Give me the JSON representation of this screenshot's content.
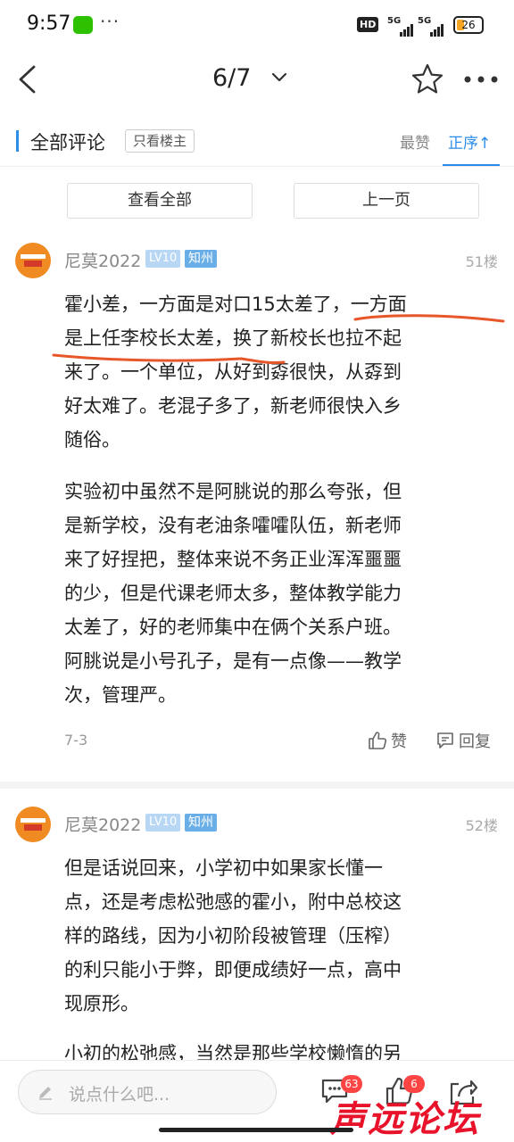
{
  "status_bar": {
    "time": "9:57",
    "dots": "···",
    "hd": "HD",
    "signal1": "5G",
    "signal2": "5G",
    "battery": "26"
  },
  "nav": {
    "page": "6/7"
  },
  "comments_header": {
    "title": "全部评论",
    "only_op": "只看楼主",
    "sort_hot": "最赞",
    "sort_order": "正序↑"
  },
  "buttons": {
    "view_all": "查看全部",
    "prev_page": "上一页"
  },
  "posts": [
    {
      "username": "尼莫2022",
      "level": "LV10",
      "tag": "知州",
      "floor": "51楼",
      "paragraphs": [
        [
          "霍小差，一方面是对口15太差了，一方面",
          "是上任李校长太差，换了新校长也拉不起",
          "来了。一个单位，从好到孬很快，从孬到",
          "好太难了。老混子多了，新老师很快入乡",
          "随俗。"
        ],
        [
          "实验初中虽然不是阿朓说的那么夸张，但",
          "是新学校，没有老油条嚯嚯队伍，新老师",
          "来了好捏把，整体来说不务正业浑浑噩噩",
          "的少，但是代课老师太多，整体教学能力",
          "太差了，好的老师集中在俩个关系户班。",
          "阿朓说是小号孔子，是有一点像——教学",
          "次，管理严。"
        ]
      ],
      "date": "7-3",
      "like": "赞",
      "reply": "回复"
    },
    {
      "username": "尼莫2022",
      "level": "LV10",
      "tag": "知州",
      "floor": "52楼",
      "paragraphs": [
        [
          "但是话说回来，小学初中如果家长懂一",
          "点，还是考虑松弛感的霍小，附中总校这",
          "样的路线，因为小初阶段被管理（压榨）",
          "的利只能小于弊，即便成绩好一点，高中",
          "现原形。"
        ],
        [
          "小初的松弛感，当然是那些学校懒惰的另"
        ]
      ]
    }
  ],
  "bottom_bar": {
    "placeholder": "说点什么吧...",
    "comment_count": "63",
    "like_count": "6"
  },
  "watermark": "声远论坛",
  "colors": {
    "accent": "#2b8cea",
    "annotation": "#e8572a",
    "badge": "#ff4444",
    "watermark": "#e8132b"
  }
}
